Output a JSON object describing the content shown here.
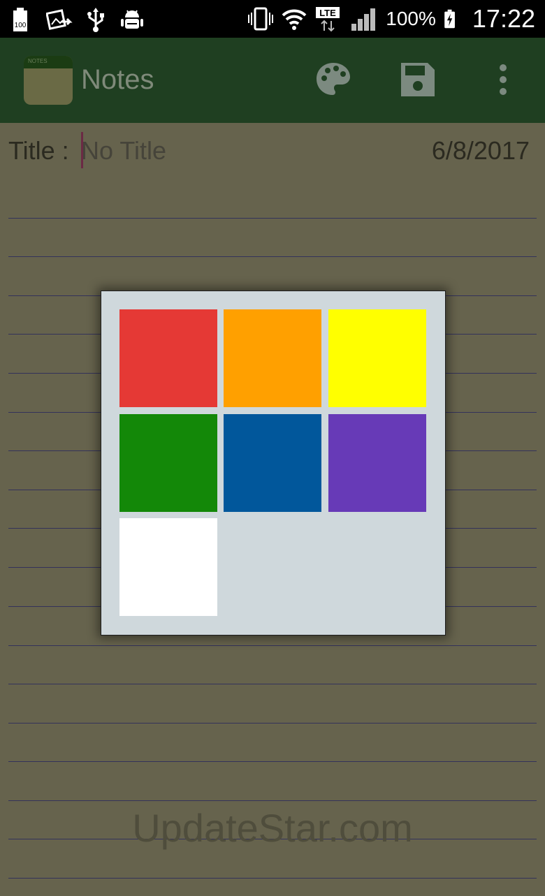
{
  "status_bar": {
    "icons_left": [
      "battery-100-icon",
      "gallery-share-icon",
      "usb-icon",
      "android-debug-icon"
    ],
    "battery_level_label": "100",
    "network_type": "LTE",
    "battery_percent": "100%",
    "time": "17:22"
  },
  "app_bar": {
    "title": "Notes",
    "logo_text": "NOTES",
    "actions": [
      "palette-icon",
      "save-icon",
      "more-vert-icon"
    ]
  },
  "note": {
    "title_label": "Title :",
    "title_placeholder": "No Title",
    "title_value": "",
    "date": "6/8/2017"
  },
  "color_picker": {
    "colors": [
      {
        "name": "red",
        "hex": "#e53935"
      },
      {
        "name": "orange",
        "hex": "#ffa000"
      },
      {
        "name": "yellow",
        "hex": "#ffff00"
      },
      {
        "name": "green",
        "hex": "#138808"
      },
      {
        "name": "blue",
        "hex": "#01579b"
      },
      {
        "name": "purple",
        "hex": "#673ab7"
      },
      {
        "name": "white",
        "hex": "#ffffff"
      }
    ]
  },
  "watermark": "UpdateStar.com",
  "theme": {
    "app_bar_color": "#1f3f21",
    "paper_color": "#66634d",
    "dialog_background": "#cfd8dc"
  }
}
